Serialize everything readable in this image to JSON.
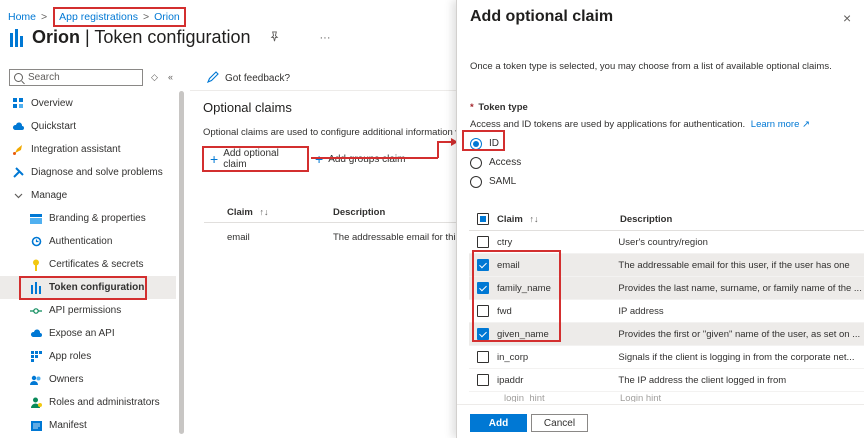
{
  "breadcrumb": {
    "home": "Home",
    "app_registrations": "App registrations",
    "app": "Orion",
    "separator": ">"
  },
  "title": {
    "app_name": "Orion",
    "divider": "|",
    "page": "Token configuration"
  },
  "icons": {
    "pin": "pin-icon",
    "more": "more-icon"
  },
  "sidebar": {
    "search_placeholder": "Search",
    "items": [
      {
        "label": "Overview",
        "icon": "grid-icon"
      },
      {
        "label": "Quickstart",
        "icon": "cloud-icon"
      },
      {
        "label": "Integration assistant",
        "icon": "rocket-icon"
      },
      {
        "label": "Diagnose and solve problems",
        "icon": "wrench-icon"
      },
      {
        "label": "Manage",
        "icon": "chevron-down-icon"
      },
      {
        "label": "Branding & properties",
        "icon": "branding-icon"
      },
      {
        "label": "Authentication",
        "icon": "refresh-icon"
      },
      {
        "label": "Certificates & secrets",
        "icon": "key-icon"
      },
      {
        "label": "Token configuration",
        "icon": "token-icon"
      },
      {
        "label": "API permissions",
        "icon": "api-icon"
      },
      {
        "label": "Expose an API",
        "icon": "cloud-icon"
      },
      {
        "label": "App roles",
        "icon": "apps-icon"
      },
      {
        "label": "Owners",
        "icon": "people-icon"
      },
      {
        "label": "Roles and administrators",
        "icon": "person-icon"
      },
      {
        "label": "Manifest",
        "icon": "manifest-icon"
      }
    ]
  },
  "main": {
    "feedback": "Got feedback?",
    "section_title": "Optional claims",
    "section_desc": "Optional claims are used to configure additional information w",
    "add_optional_claim": "Add optional claim",
    "add_groups_claim": "Add groups claim",
    "col_claim": "Claim",
    "col_description": "Description",
    "sort_glyph": "↑↓",
    "row_claim": "email",
    "row_desc": "The addressable email for this"
  },
  "panel": {
    "title": "Add optional claim",
    "close": "×",
    "intro": "Once a token type is selected, you may choose from a list of available optional claims.",
    "token_type_label": "Token type",
    "required_mark": "*",
    "token_type_desc": "Access and ID tokens are used by applications for authentication.",
    "learn_more": "Learn more",
    "external_link": "↗",
    "options": [
      "ID",
      "Access",
      "SAML"
    ],
    "selected_option": "ID",
    "col_claim": "Claim",
    "col_description": "Description",
    "sort_glyph": "↑↓",
    "claims": [
      {
        "name": "ctry",
        "description": "User's country/region",
        "checked": false
      },
      {
        "name": "email",
        "description": "The addressable email for this user, if the user has one",
        "checked": true
      },
      {
        "name": "family_name",
        "description": "Provides the last name, surname, or family name of the ...",
        "checked": true
      },
      {
        "name": "fwd",
        "description": "IP address",
        "checked": false
      },
      {
        "name": "given_name",
        "description": "Provides the first or \"given\" name of the user, as set on ...",
        "checked": true
      },
      {
        "name": "in_corp",
        "description": "Signals if the client is logging in from the corporate net...",
        "checked": false
      },
      {
        "name": "ipaddr",
        "description": "The IP address the client logged in from",
        "checked": false
      }
    ],
    "cut_row": {
      "name": "login_hint",
      "description": "Login hint"
    },
    "add_button": "Add",
    "cancel_button": "Cancel"
  },
  "colors": {
    "accent": "#0078d4",
    "highlight_box": "#d32f2f"
  }
}
